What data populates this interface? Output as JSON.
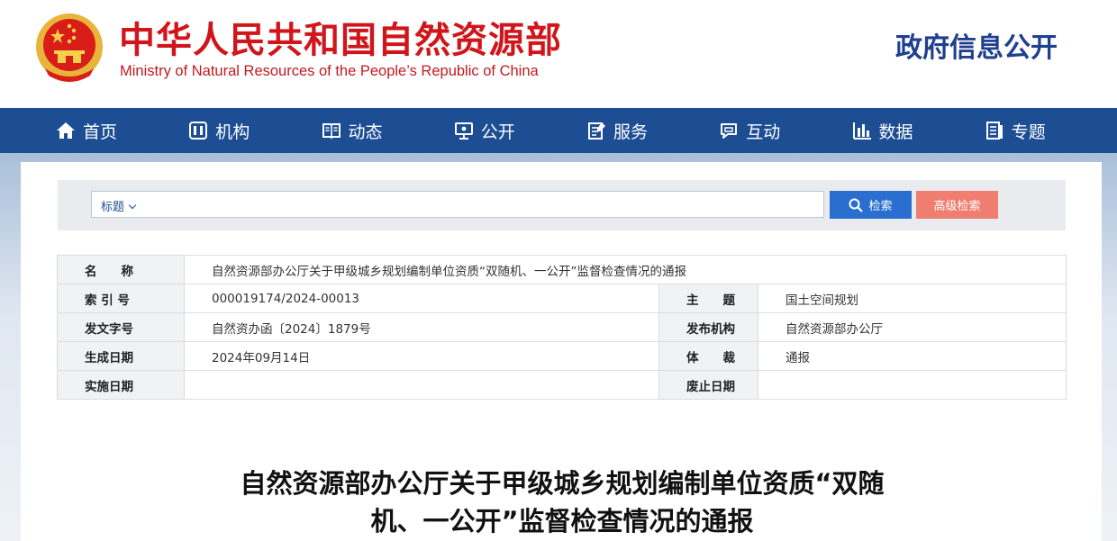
{
  "header": {
    "title_cn": "中华人民共和国自然资源部",
    "title_en": "Ministry of Natural Resources of the People’s Republic of China",
    "section_title": "政府信息公开",
    "emblem_icon": "national-emblem-icon"
  },
  "nav": {
    "items": [
      {
        "label": "首页",
        "icon": "home-icon"
      },
      {
        "label": "机构",
        "icon": "organization-icon"
      },
      {
        "label": "动态",
        "icon": "book-icon"
      },
      {
        "label": "公开",
        "icon": "monitor-icon"
      },
      {
        "label": "服务",
        "icon": "edit-document-icon"
      },
      {
        "label": "互动",
        "icon": "chat-icon"
      },
      {
        "label": "数据",
        "icon": "bar-chart-icon"
      },
      {
        "label": "专题",
        "icon": "topic-icon"
      }
    ]
  },
  "search": {
    "type_label": "标题",
    "value": "",
    "search_button": "检索",
    "advanced_button": "高级检索"
  },
  "meta": {
    "name_label": "名　　称",
    "name_value": "自然资源部办公厅关于甲级城乡规划编制单位资质“双随机、一公开”监督检查情况的通报",
    "index_label": "索 引 号",
    "index_value": "000019174/2024-00013",
    "topic_label": "主　　题",
    "topic_value": "国土空间规划",
    "docno_label": "发文字号",
    "docno_value": "自然资办函〔2024〕1879号",
    "publisher_label": "发布机构",
    "publisher_value": "自然资源部办公厅",
    "created_label": "生成日期",
    "created_value": "2024年09月14日",
    "genre_label": "体　　裁",
    "genre_value": "通报",
    "effective_label": "实施日期",
    "effective_value": "",
    "expiry_label": "废止日期",
    "expiry_value": ""
  },
  "document": {
    "title_line1": "自然资源部办公厅关于甲级城乡规划编制单位资质“双随",
    "title_line2": "机、一公开”监督检查情况的通报"
  },
  "colors": {
    "brand_red": "#d0151b",
    "nav_blue": "#1d4e94",
    "search_blue": "#2a6fd0",
    "advanced_salmon": "#f07e70"
  }
}
